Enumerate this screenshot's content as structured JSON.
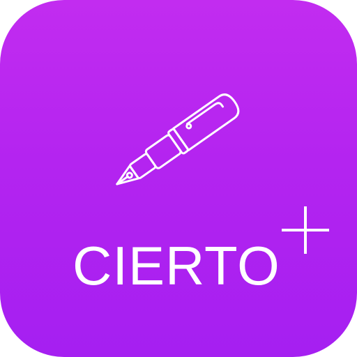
{
  "app_icon": {
    "name": "CIERTO",
    "accent_color": "#b424f0",
    "glyph_color": "#ffffff",
    "icons": [
      "fountain-pen-icon",
      "plus-icon"
    ]
  }
}
